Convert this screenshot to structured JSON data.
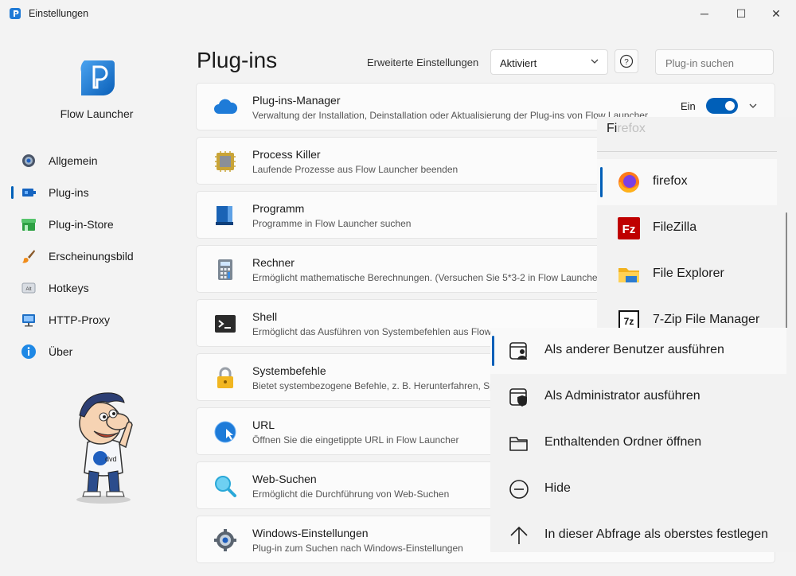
{
  "window": {
    "title": "Einstellungen",
    "app_icon": "flow-launcher-icon"
  },
  "window_controls": {
    "minimize": "─",
    "maximize": "☐",
    "close": "✕"
  },
  "sidebar": {
    "app_name": "Flow Launcher",
    "items": [
      {
        "label": "Allgemein",
        "icon": "gear-icon"
      },
      {
        "label": "Plug-ins",
        "icon": "plugin-icon",
        "active": true
      },
      {
        "label": "Plug-in-Store",
        "icon": "store-icon"
      },
      {
        "label": "Erscheinungsbild",
        "icon": "brush-icon"
      },
      {
        "label": "Hotkeys",
        "icon": "keyboard-key-icon"
      },
      {
        "label": "HTTP-Proxy",
        "icon": "monitor-network-icon"
      },
      {
        "label": "Über",
        "icon": "info-icon"
      }
    ],
    "alt_key_text": "Alt",
    "mascot_text": "dvd"
  },
  "header": {
    "title": "Plug-ins",
    "advanced_label": "Erweiterte Einstellungen",
    "advanced_value": "Aktiviert",
    "help_symbol": "?",
    "search_placeholder": "Plug-in suchen"
  },
  "plugins": [
    {
      "name": "Plug-ins-Manager",
      "description": "Verwaltung der Installation, Deinstallation oder Aktualisierung der Plug-ins von Flow Launcher",
      "icon": "cloud-icon",
      "toggle_label": "Ein",
      "enabled": true
    },
    {
      "name": "Process Killer",
      "description": "Laufende Prozesse aus Flow Launcher beenden",
      "icon": "chip-icon"
    },
    {
      "name": "Programm",
      "description": "Programme in Flow Launcher suchen",
      "icon": "program-icon"
    },
    {
      "name": "Rechner",
      "description": "Ermöglicht mathematische Berechnungen. (Versuchen Sie 5*3-2 in Flow Launcher)",
      "icon": "calculator-icon"
    },
    {
      "name": "Shell",
      "description": "Ermöglicht das Ausführen von Systembefehlen aus Flow Launcher",
      "icon": "terminal-icon"
    },
    {
      "name": "Systembefehle",
      "description": "Bietet systembezogene Befehle, z. B. Herunterfahren, Sperren",
      "icon": "lock-icon"
    },
    {
      "name": "URL",
      "description": "Öffnen Sie die eingetippte URL in Flow Launcher",
      "icon": "url-icon"
    },
    {
      "name": "Web-Suchen",
      "description": "Ermöglicht die Durchführung von Web-Suchen",
      "icon": "web-search-icon"
    },
    {
      "name": "Windows-Einstellungen",
      "description": "Plug-in zum Suchen nach Windows-Einstellungen",
      "icon": "windows-settings-icon"
    }
  ],
  "launcher": {
    "query_typed": "Fi",
    "query_suggestion": "refox",
    "results": [
      {
        "label": "firefox",
        "icon": "firefox-icon",
        "selected": true
      },
      {
        "label": "FileZilla",
        "icon": "filezilla-icon"
      },
      {
        "label": "File Explorer",
        "icon": "folder-icon"
      },
      {
        "label": "7-Zip File Manager",
        "icon": "7zip-icon"
      }
    ],
    "filezilla_glyph": "Fz",
    "sevenzip_glyph": "7z"
  },
  "context_menu": {
    "items": [
      {
        "label": "Als anderer Benutzer ausführen",
        "icon": "user-window-icon",
        "selected": true
      },
      {
        "label": "Als Administrator ausführen",
        "icon": "shield-window-icon"
      },
      {
        "label": "Enthaltenden Ordner öffnen",
        "icon": "folder-outline-icon"
      },
      {
        "label": "Hide",
        "icon": "minus-circle-icon"
      },
      {
        "label": "In dieser Abfrage als oberstes festlegen",
        "icon": "arrow-up-icon"
      }
    ]
  },
  "colors": {
    "accent": "#005fb8",
    "background": "#f3f3f3",
    "card": "#fbfbfb"
  }
}
